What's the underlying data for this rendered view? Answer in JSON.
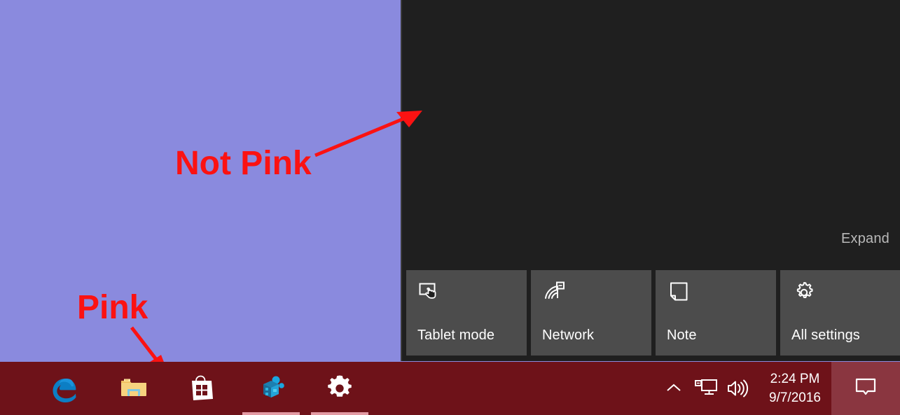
{
  "desktop": {
    "background_color": "#8a8ade",
    "name": "windows-desktop"
  },
  "action_center": {
    "background_color": "#1f1f1f",
    "expand_label": "Expand",
    "tiles": [
      {
        "label": "Tablet mode",
        "icon": "tablet-mode-icon"
      },
      {
        "label": "Network",
        "icon": "network-wifi-icon"
      },
      {
        "label": "Note",
        "icon": "note-icon"
      },
      {
        "label": "All settings",
        "icon": "gear-icon"
      }
    ],
    "tile_color": "#4c4c4c"
  },
  "taskbar": {
    "background_color": "#6e1219",
    "accent_underline_color": "#e39aa3",
    "apps": [
      {
        "name": "microsoft-edge",
        "label": "Microsoft Edge",
        "active": false
      },
      {
        "name": "file-explorer",
        "label": "File Explorer",
        "active": false
      },
      {
        "name": "microsoft-store",
        "label": "Store",
        "active": false
      },
      {
        "name": "3d-builder",
        "label": "3D Builder",
        "active": true
      },
      {
        "name": "settings",
        "label": "Settings",
        "active": true
      }
    ],
    "tray": {
      "show_hidden_icons": "chevron-up-icon",
      "network": "network-pc-icon",
      "volume": "speaker-icon",
      "time": "2:24 PM",
      "date": "9/7/2016",
      "action_center": "action-center-icon",
      "action_center_highlight_color": "#8a3640"
    }
  },
  "annotations": [
    {
      "text": "Not Pink",
      "color": "#fb1212",
      "points_to": "action-center-panel"
    },
    {
      "text": "Pink",
      "color": "#fb1212",
      "points_to": "taskbar"
    }
  ]
}
